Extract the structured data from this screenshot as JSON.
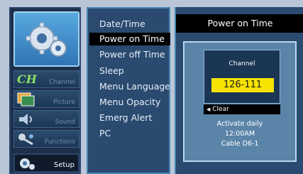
{
  "sidebar": {
    "items": [
      {
        "label": "Channel",
        "icon": "channel-icon"
      },
      {
        "label": "Picture",
        "icon": "picture-icon"
      },
      {
        "label": "Sound",
        "icon": "sound-icon"
      },
      {
        "label": "Functions",
        "icon": "functions-icon"
      },
      {
        "label": "Setup",
        "icon": "setup-icon",
        "active": true
      }
    ],
    "hero_icon": "gears-icon",
    "channel_icon_text": "CH"
  },
  "menu": {
    "items": [
      "Date/Time",
      "Power on Time",
      "Power off Time",
      "Sleep",
      "Menu Language",
      "Menu Opacity",
      "Emerg Alert",
      "PC"
    ],
    "selected_index": 1
  },
  "detail": {
    "title": "Power on Time",
    "channel_label": "Channel",
    "channel_value": "126-111",
    "clear_label": "Clear",
    "clear_icon": "arrow-left-icon",
    "schedule": [
      "Activate daily",
      "12:00AM",
      "Cable D6-1"
    ]
  },
  "colors": {
    "highlight": "#f6e300",
    "panel": "#2a4a6f",
    "border": "#4a87b3",
    "selected_bg": "#000000"
  }
}
